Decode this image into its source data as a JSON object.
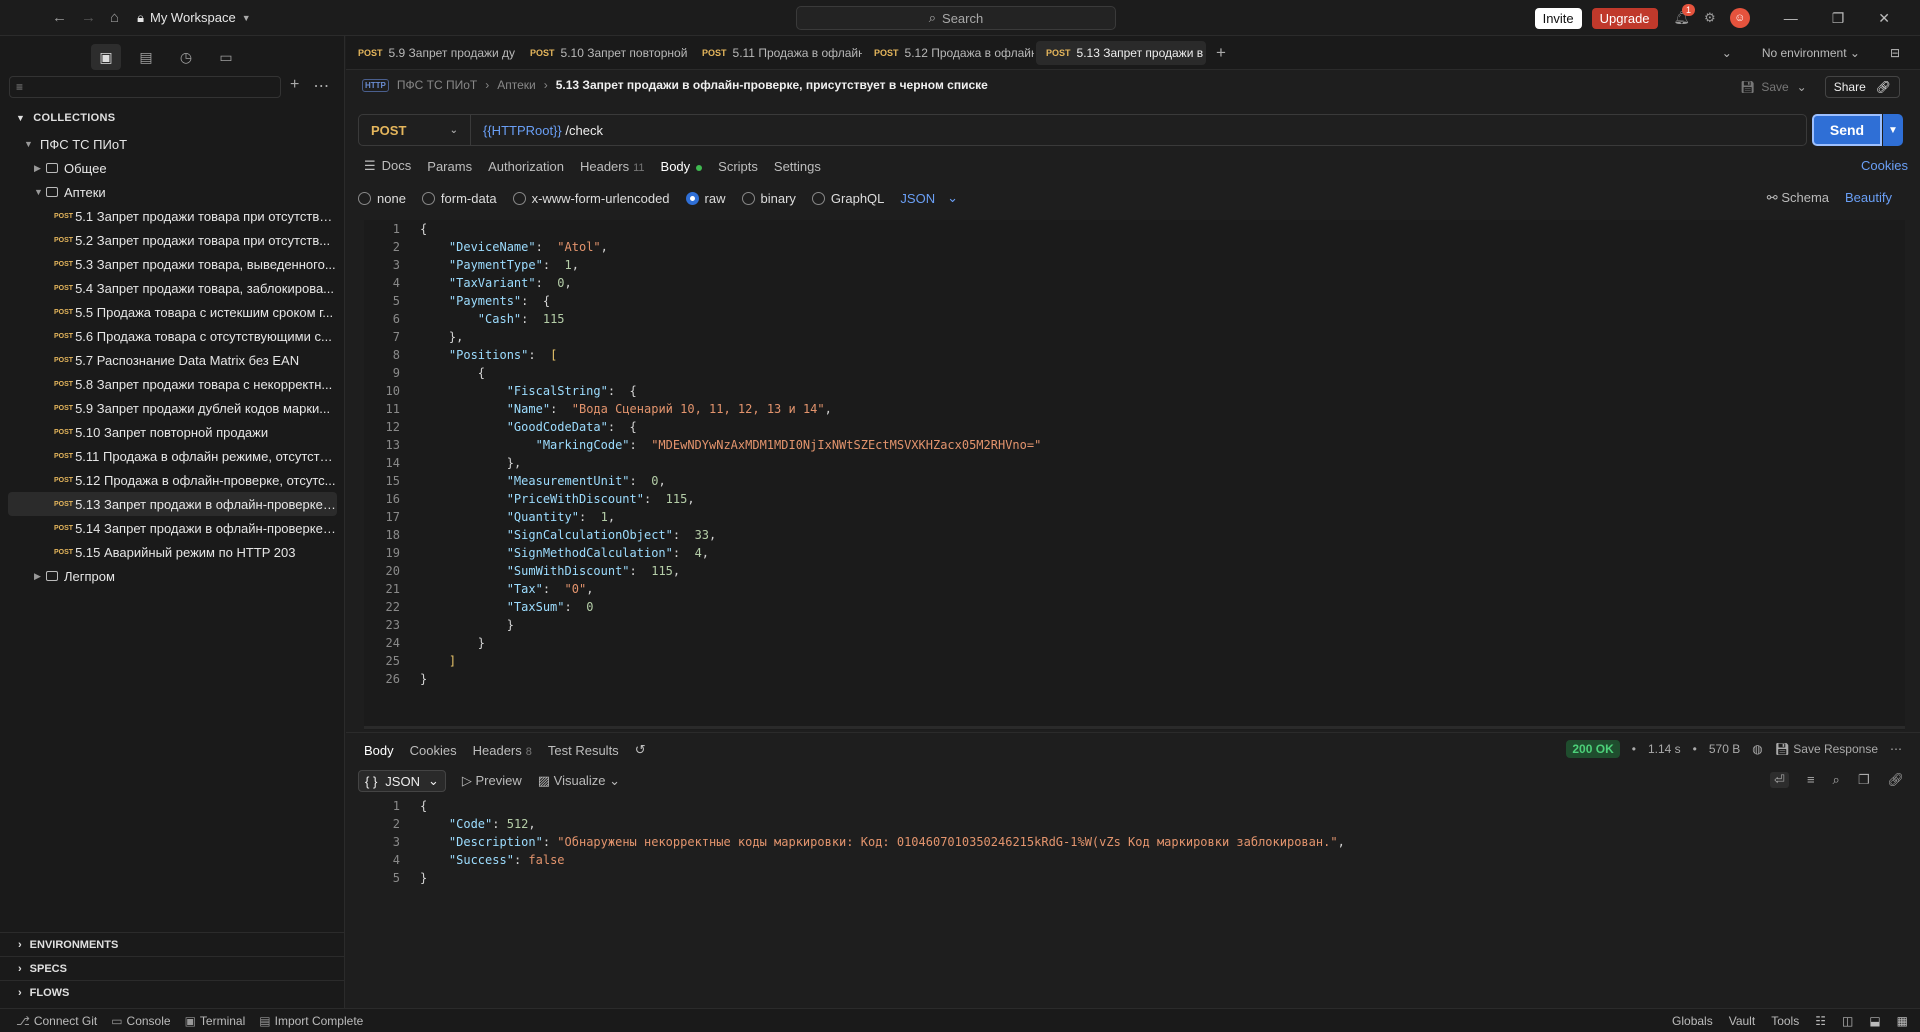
{
  "topbar": {
    "workspace": "My Workspace",
    "search_placeholder": "Search",
    "invite": "Invite",
    "upgrade": "Upgrade",
    "notifications_count": "1"
  },
  "sidebar": {
    "collections_label": "COLLECTIONS",
    "collection_name": "ПФС ТС ПИоТ",
    "folders": [
      "Общее",
      "Аптеки",
      "Легпром"
    ],
    "method_tag": "POST",
    "requests": [
      "5.1 Запрет продажи товара при отсутствии...",
      "5.2 Запрет продажи товара при отсутств...",
      "5.3 Запрет продажи товара, выведенного...",
      "5.4 Запрет продажи товара, заблокирова...",
      "5.5 Продажа товара с истекшим сроком г...",
      "5.6 Продажа товара с отсутствующими с...",
      "5.7 Распознание Data Matrix без EAN",
      "5.8 Запрет продажи товара с некорректн...",
      "5.9 Запрет продажи дублей кодов марки...",
      "5.10 Запрет повторной продажи",
      "5.11 Продажа в офлайн режиме, отсутств...",
      "5.12 Продажа в офлайн-проверке, отсутс...",
      "5.13 Запрет продажи в офлайн-проверке,...",
      "5.14 Запрет продажи в офлайн-проверке ...",
      "5.15 Аварийный режим по HTTP 203"
    ],
    "selected_index": 12,
    "sections": [
      "ENVIRONMENTS",
      "SPECS",
      "FLOWS"
    ]
  },
  "tabs": {
    "items": [
      {
        "method": "POST",
        "label": "5.9 Запрет продажи ду"
      },
      {
        "method": "POST",
        "label": "5.10 Запрет повторной"
      },
      {
        "method": "POST",
        "label": "5.11 Продажа в офлайн"
      },
      {
        "method": "POST",
        "label": "5.12 Продажа в офлайн"
      },
      {
        "method": "POST",
        "label": "5.13 Запрет продажи в"
      }
    ],
    "environment": "No environment"
  },
  "breadcrumb": {
    "http_tag": "HTTP",
    "collection": "ПФС ТС ПИоТ",
    "folder": "Аптеки",
    "current": "5.13 Запрет продажи в офлайн-проверке, присутствует в черном списке",
    "save": "Save",
    "share": "Share"
  },
  "request": {
    "method": "POST",
    "url_var": "{{HTTPRoot}}",
    "url_path": " /check",
    "send": "Send",
    "tabs": [
      "Docs",
      "Params",
      "Authorization",
      "Headers",
      "Body",
      "Scripts",
      "Settings"
    ],
    "headers_count": "11",
    "cookies": "Cookies",
    "body_types": [
      "none",
      "form-data",
      "x-www-form-urlencoded",
      "raw",
      "binary",
      "GraphQL"
    ],
    "body_format": "JSON",
    "schema": "Schema",
    "beautify": "Beautify"
  },
  "body_lines": [
    "{",
    "    \"DeviceName\":  \"Atol\",",
    "    \"PaymentType\":  1,",
    "    \"TaxVariant\":  0,",
    "    \"Payments\":  {",
    "        \"Cash\":  115",
    "    },",
    "    \"Positions\":  [",
    "        {",
    "            \"FiscalString\":  {",
    "            \"Name\":  \"Вода Сценарий 10, 11, 12, 13 и 14\",",
    "            \"GoodCodeData\":  {",
    "                \"MarkingCode\":  \"MDEwNDYwNzAxMDM1MDI0NjIxNWtSZEctMSVXKHZacx05M2RHVno=\"",
    "            },",
    "            \"MeasurementUnit\":  0,",
    "            \"PriceWithDiscount\":  115,",
    "            \"Quantity\":  1,",
    "            \"SignCalculationObject\":  33,",
    "            \"SignMethodCalculation\":  4,",
    "            \"SumWithDiscount\":  115,",
    "            \"Tax\":  \"0\",",
    "            \"TaxSum\":  0",
    "            }",
    "        }",
    "    ]",
    "}"
  ],
  "response": {
    "tabs": [
      "Body",
      "Cookies",
      "Headers",
      "Test Results"
    ],
    "headers_count": "8",
    "status": "200 OK",
    "time": "1.14 s",
    "size": "570 B",
    "save_response": "Save Response",
    "format": "JSON",
    "preview": "Preview",
    "visualize": "Visualize",
    "lines": [
      "{",
      "    \"Code\": 512,",
      "    \"Description\": \"Обнаружены некорректные коды маркировки: Код: 0104607010350246215kRdG-1%W(vZs Код маркировки заблокирован.\",",
      "    \"Success\": false",
      "}"
    ]
  },
  "footer": {
    "left": [
      "Connect Git",
      "Console",
      "Terminal",
      "Import Complete"
    ],
    "right": [
      "Globals",
      "Vault",
      "Tools"
    ]
  }
}
